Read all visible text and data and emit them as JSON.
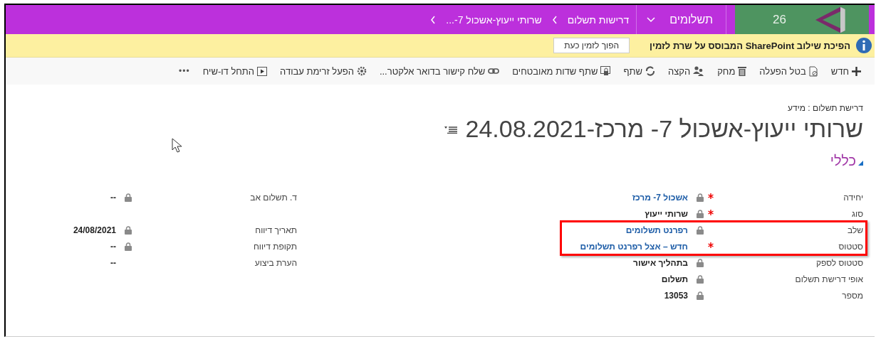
{
  "nav": {
    "tile_number": "26",
    "app": "תשלומים",
    "breadcrumbs": [
      "דרישות תשלום",
      "שרותי ייעוץ-אשכול 7-..."
    ]
  },
  "notice": {
    "message": "הפיכת שילוב SharePoint המבוסס על שרת לזמין",
    "button": "הפוך לזמין כעת"
  },
  "toolbar": [
    {
      "label": "חדש",
      "kind": "new"
    },
    {
      "label": "בטל הפעלה",
      "kind": "deactivate"
    },
    {
      "label": "מחק",
      "kind": "delete"
    },
    {
      "label": "הקצה",
      "kind": "assign"
    },
    {
      "label": "שתף",
      "kind": "share"
    },
    {
      "label": "שתף שדות מאובטחים",
      "kind": "secure"
    },
    {
      "label": "שלח קישור בדואר אלקטר...",
      "kind": "email"
    },
    {
      "label": "הפעל זרימת עבודה",
      "kind": "workflow"
    },
    {
      "label": "התחל דו-שיח",
      "kind": "dialog"
    },
    {
      "label": "•••",
      "kind": "more"
    }
  ],
  "form": {
    "entity_path": "דרישת תשלום : מידע",
    "title": "שרותי ייעוץ-אשכול 7- מרכז-24.08.2021",
    "section": "כללי",
    "fields_main": [
      {
        "label": "יחידה",
        "value": "אשכול 7- מרכז",
        "kind": "link",
        "required": true,
        "locked": true,
        "highlighted": false
      },
      {
        "label": "סוג",
        "value": "שרותי ייעוץ",
        "kind": "text",
        "required": true,
        "locked": true,
        "highlighted": false
      },
      {
        "label": "שלב",
        "value": "רפרנט תשלומים",
        "kind": "link",
        "required": false,
        "locked": true,
        "highlighted": true
      },
      {
        "label": "סטטוס",
        "value": "חדש – אצל רפרנט תשלומים",
        "kind": "link",
        "required": true,
        "locked": false,
        "highlighted": true
      },
      {
        "label": "סטטוס לספק",
        "value": "בתהליך אישור",
        "kind": "text",
        "required": false,
        "locked": true,
        "highlighted": false
      },
      {
        "label": "אופי דרישת תשלום",
        "value": "תשלום",
        "kind": "text",
        "required": false,
        "locked": true,
        "highlighted": false
      },
      {
        "label": "מספר",
        "value": "13053",
        "kind": "text",
        "required": false,
        "locked": true,
        "highlighted": false
      }
    ],
    "fields_side": [
      {
        "label": "ד. תשלום אב",
        "value": "--",
        "locked": true
      },
      {
        "label": "תאריך דיווח",
        "value": "24/08/2021",
        "locked": true
      },
      {
        "label": "תקופת דיווח",
        "value": "--",
        "locked": true
      },
      {
        "label": "הערת ביצוע",
        "value": "--",
        "locked": false
      }
    ]
  }
}
